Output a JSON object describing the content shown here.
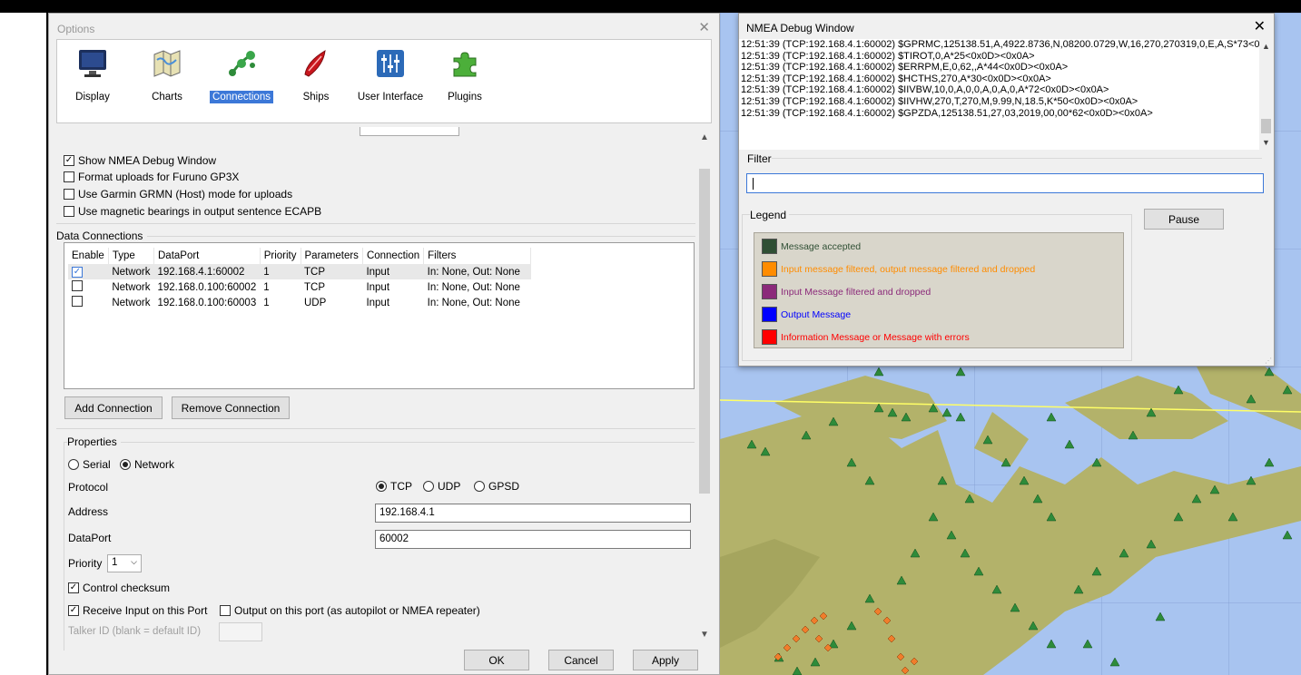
{
  "options": {
    "title": "Options",
    "close_glyph": "✕",
    "toolbar": [
      {
        "label": "Display",
        "icon": "monitor-icon"
      },
      {
        "label": "Charts",
        "icon": "chart-map-icon"
      },
      {
        "label": "Connections",
        "icon": "connections-icon",
        "selected": true
      },
      {
        "label": "Ships",
        "icon": "ship-icon"
      },
      {
        "label": "User Interface",
        "icon": "sliders-icon"
      },
      {
        "label": "Plugins",
        "icon": "puzzle-icon"
      }
    ],
    "general_options": [
      {
        "label": "Show NMEA Debug Window",
        "checked": true
      },
      {
        "label": "Format uploads for Furuno GP3X",
        "checked": false
      },
      {
        "label": "Use Garmin GRMN (Host) mode for uploads",
        "checked": false
      },
      {
        "label": "Use magnetic bearings in output sentence ECAPB",
        "checked": false
      }
    ],
    "data_connections": {
      "title": "Data Connections",
      "columns": [
        "Enable",
        "Type",
        "DataPort",
        "Priority",
        "Parameters",
        "Connection",
        "Filters"
      ],
      "rows": [
        {
          "enabled": true,
          "type": "Network",
          "dataport": "192.168.4.1:60002",
          "priority": "1",
          "parameters": "TCP",
          "connection": "Input",
          "filters": "In: None, Out: None"
        },
        {
          "enabled": false,
          "type": "Network",
          "dataport": "192.168.0.100:60002",
          "priority": "1",
          "parameters": "TCP",
          "connection": "Input",
          "filters": "In: None, Out: None"
        },
        {
          "enabled": false,
          "type": "Network",
          "dataport": "192.168.0.100:60003",
          "priority": "1",
          "parameters": "UDP",
          "connection": "Input",
          "filters": "In: None, Out: None"
        }
      ],
      "add_button": "Add Connection",
      "remove_button": "Remove Connection"
    },
    "properties": {
      "title": "Properties",
      "serial_label": "Serial",
      "network_label": "Network",
      "protocol_label": "Protocol",
      "protocol_options": [
        "TCP",
        "UDP",
        "GPSD"
      ],
      "address_label": "Address",
      "address_value": "192.168.4.1",
      "dataport_label": "DataPort",
      "dataport_value": "60002",
      "priority_label": "Priority",
      "priority_value": "1",
      "control_checksum": "Control checksum",
      "receive_input": "Receive Input on this Port",
      "output_port": "Output on this port (as autopilot or NMEA repeater)",
      "talker_id": "Talker ID (blank = default ID)"
    },
    "footer": {
      "ok": "OK",
      "cancel": "Cancel",
      "apply": "Apply"
    }
  },
  "nmea": {
    "title": "NMEA Debug Window",
    "close_glyph": "✕",
    "log": [
      "12:51:39 (TCP:192.168.4.1:60002) $GPRMC,125138.51,A,4922.8736,N,08200.0729,W,16,270,270319,0,E,A,S*73<0",
      "12:51:39 (TCP:192.168.4.1:60002) $TIROT,0,A*25<0x0D><0x0A>",
      "12:51:39 (TCP:192.168.4.1:60002) $ERRPM,E,0,62,,A*44<0x0D><0x0A>",
      "12:51:39 (TCP:192.168.4.1:60002) $HCTHS,270,A*30<0x0D><0x0A>",
      "12:51:39 (TCP:192.168.4.1:60002) $IIVBW,10,0,A,0,0,A,0,A,0,A*72<0x0D><0x0A>",
      "12:51:39 (TCP:192.168.4.1:60002) $IIVHW,270,T,270,M,9.99,N,18.5,K*50<0x0D><0x0A>",
      "12:51:39 (TCP:192.168.4.1:60002) $GPZDA,125138.51,27,03,2019,00,00*62<0x0D><0x0A>"
    ],
    "filter_label": "Filter",
    "legend_label": "Legend",
    "pause_button": "Pause",
    "legend": [
      {
        "label": "Message accepted",
        "color": "#2f4f34",
        "text_color": "#2f4f34"
      },
      {
        "label": "Input message filtered, output message filtered and dropped",
        "color": "#ff8c00",
        "text_color": "#ff8c00"
      },
      {
        "label": "Input Message filtered and dropped",
        "color": "#8b2a7a",
        "text_color": "#8b2a7a"
      },
      {
        "label": "Output Message",
        "color": "#0000ff",
        "text_color": "#0000ff"
      },
      {
        "label": "Information Message or Message with errors",
        "color": "#ff0000",
        "text_color": "#ff0000"
      }
    ]
  }
}
